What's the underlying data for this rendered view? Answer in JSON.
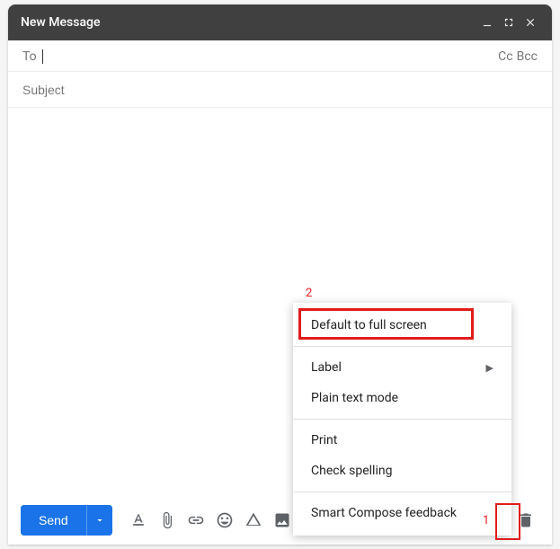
{
  "header": {
    "title": "New Message"
  },
  "recipients": {
    "to_label": "To",
    "cc_label": "Cc",
    "bcc_label": "Bcc"
  },
  "subject": {
    "placeholder": "Subject",
    "value": ""
  },
  "body": {
    "value": ""
  },
  "toolbar": {
    "send_label": "Send"
  },
  "menu": {
    "items": {
      "fullscreen": "Default to full screen",
      "label": "Label",
      "plaintext": "Plain text mode",
      "print": "Print",
      "spell": "Check spelling",
      "smart": "Smart Compose feedback"
    }
  },
  "annotations": {
    "label_1": "1",
    "label_2": "2"
  }
}
